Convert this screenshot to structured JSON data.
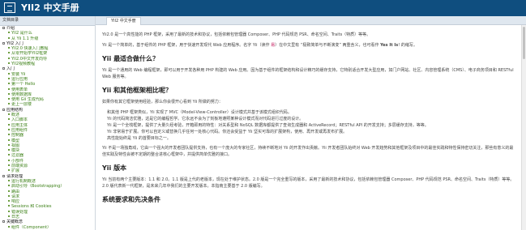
{
  "header": {
    "title": "YII2 中文手册"
  },
  "sidebar": {
    "heading": "文档目录",
    "items": [
      {
        "label": "介绍",
        "kind": "section"
      },
      {
        "label": "YII2 是什么",
        "kind": "item"
      },
      {
        "label": "从 Yii 1.1 升级",
        "kind": "item"
      },
      {
        "label": "YII2 入门",
        "kind": "section"
      },
      {
        "label": "YII2.0 快速入门教程",
        "kind": "item"
      },
      {
        "label": "从零开始学YII2框架",
        "kind": "item"
      },
      {
        "label": "YII2.0中文开发向导",
        "kind": "item"
      },
      {
        "label": "YII2视频教程",
        "kind": "item"
      },
      {
        "label": "入门",
        "kind": "section"
      },
      {
        "label": "安装 Yii",
        "kind": "item"
      },
      {
        "label": "运行应用",
        "kind": "item"
      },
      {
        "label": "第一个 Hello",
        "kind": "item"
      },
      {
        "label": "使用表单",
        "kind": "item"
      },
      {
        "label": "使用数据库",
        "kind": "item"
      },
      {
        "label": "使用 Gii 生成代码",
        "kind": "item"
      },
      {
        "label": "更上一层楼",
        "kind": "item"
      },
      {
        "label": "应用结构",
        "kind": "section"
      },
      {
        "label": "概述",
        "kind": "item"
      },
      {
        "label": "入口脚本",
        "kind": "item"
      },
      {
        "label": "应用主体",
        "kind": "item"
      },
      {
        "label": "应用组件",
        "kind": "item"
      },
      {
        "label": "控制器",
        "kind": "item"
      },
      {
        "label": "模型",
        "kind": "item"
      },
      {
        "label": "视图",
        "kind": "item"
      },
      {
        "label": "模块",
        "kind": "item"
      },
      {
        "label": "过滤器",
        "kind": "item"
      },
      {
        "label": "小部件",
        "kind": "item"
      },
      {
        "label": "前端资源",
        "kind": "item"
      },
      {
        "label": "扩展",
        "kind": "item"
      },
      {
        "label": "请求处理",
        "kind": "section"
      },
      {
        "label": "运行机制概述",
        "kind": "item"
      },
      {
        "label": "启动引导（Bootstrapping）",
        "kind": "item"
      },
      {
        "label": "路由",
        "kind": "item"
      },
      {
        "label": "请求",
        "kind": "item"
      },
      {
        "label": "响应",
        "kind": "item"
      },
      {
        "label": "Sessions 和 Cookies",
        "kind": "item"
      },
      {
        "label": "错误处理",
        "kind": "item"
      },
      {
        "label": "日志",
        "kind": "item"
      },
      {
        "label": "关键概念",
        "kind": "section"
      },
      {
        "label": "组件（Component）",
        "kind": "item"
      }
    ]
  },
  "tabs": [
    {
      "label": "YII2 中文手册"
    }
  ],
  "content": {
    "intro": "Yii2.0 是一个高性能的 PHP 框架，采用了最新的技术和协议，包括依赖包管理器 Composer、PHP 代码规范 PSR、命名空间、Traits（特质）等等。",
    "intro_line2_a": "Yii 是一个简单的，基于组件的 PHP 框架，用于快速开发现代 Web 应用程序。名字 Yii（读作 ",
    "intro_line2_yi": "易",
    "intro_line2_b": "）在中文里有 “极致简单与不断演变” 两重含义，也可看作 ",
    "intro_line2_yes": "Yes It Is",
    "intro_line2_c": "! 的缩写。",
    "h_best": "Yii 最适合做什么？",
    "best_text": "Yii 是一个通用的 Web 编程框架，即可以用于开发各种用 PHP 构建的 Web 应用。因为基于组件的框架结构和设计精巧的缓存支持，它特别适合开发大型应用，如门户网站、社区、内容管理系统（CMS）、电子商务项目和 RESTful Web 服务等。",
    "h_compare": "Yii 和其他框架相比呢？",
    "compare_intro": "如果你有其它框架使用经验，那么你会很开心看到 Yii 所做的努力：",
    "bullets": [
      "和其他 PHP 框架类似，Yii 实现了 MVC（Model-View-Controller）设计模式并基于该模式组织代码。",
      "Yii 的代码简洁优雅，这是它的编程哲学。它永远不会为了刻板地遵照某种设计模式而对代码进行过度的设计。",
      "Yii 是一个全栈框架，提供了大量久经考验，开箱即用的特性：对关系型和 NoSQL 数据库都提供了查询生成器和 ActiveRecord；RESTful API 的开发支持；多层缓存支持，等等。",
      "Yii 非常易于扩展。你可以自定义或替换几乎任何一处核心代码。你还会受益于 Yii 坚实可靠的扩展架构，使用、再开发或再发布扩展。",
      "高性能始终是 Yii 的首要目标之一。"
    ],
    "team_text": "Yii 不是一场独角戏，它由一个强大的开发者团队提供支持，也有一个庞大的专家社区，持续不断地对 Yii 的开发作出贡献。Yii 开发者团队始终对 Web 开发趋势和其他框架及项目中的最佳实践和特性保持密切关注，那些有意义的最佳实践及特性会被不定期的整合进核心框架中，并提供简单优雅的接口。",
    "h_version": "Yii 版本",
    "version_text": "Yii 当前有两个主要版本：1.1 和 2.0。1.1 版是上代的老版本，现在处于维护状态。2.0 版是一个完全重写的版本，采用了最新的技术和协议，包括依赖包管理器 Composer、PHP 代码规范 PSR、命名空间、Traits（特质）等等。2.0 版代表新一代框架，是未来几年中我们的主要开发版本。本指南主要基于 2.0 版编写。",
    "h_requirements": "系统要求和先决条件"
  },
  "icons": {
    "logo": "book-icon"
  },
  "colors": {
    "header": "#0f4e7f",
    "tree_link": "#3a7f14"
  }
}
